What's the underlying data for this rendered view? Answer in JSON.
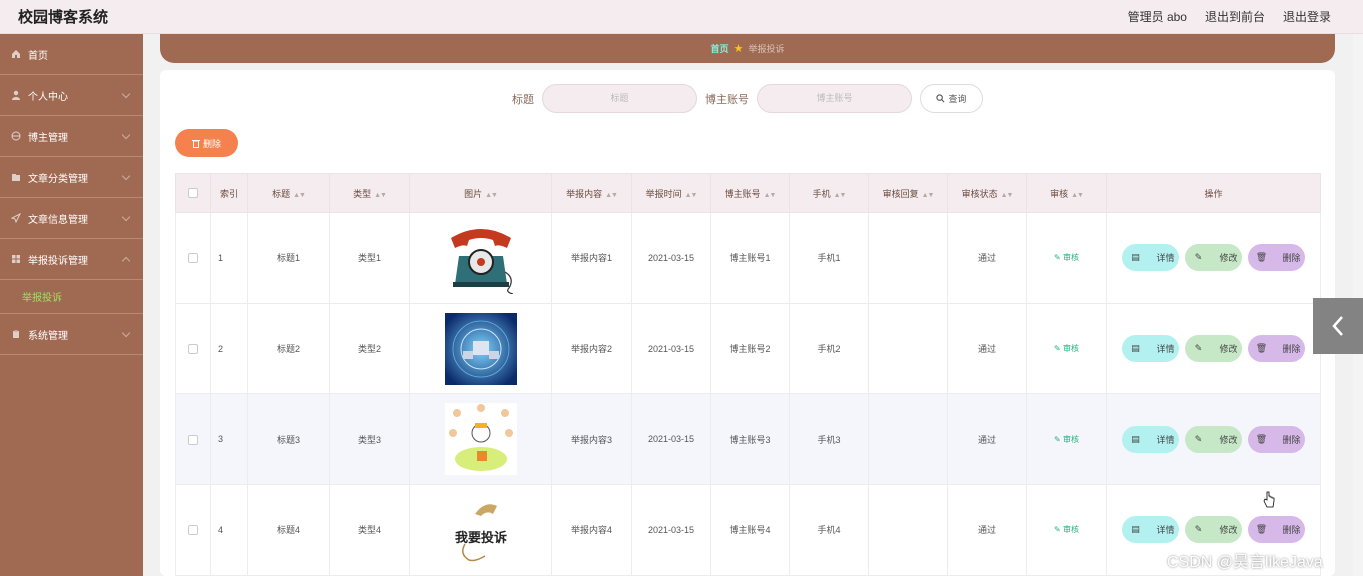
{
  "app_title": "校园博客系统",
  "header": {
    "admin_label": "管理员 abo",
    "to_front_label": "退出到前台",
    "logout_label": "退出登录"
  },
  "sidebar": {
    "items": [
      {
        "label": "首页",
        "icon": "home-icon"
      },
      {
        "label": "个人中心",
        "icon": "user-icon"
      },
      {
        "label": "博主管理",
        "icon": "globe-icon"
      },
      {
        "label": "文章分类管理",
        "icon": "folder-icon"
      },
      {
        "label": "文章信息管理",
        "icon": "send-icon"
      },
      {
        "label": "举报投诉管理",
        "icon": "grid-icon"
      },
      {
        "label": "系统管理",
        "icon": "clipboard-icon"
      }
    ],
    "sub_active": "举报投诉"
  },
  "breadcrumb": {
    "home": "首页",
    "current": "举报投诉"
  },
  "search": {
    "title_label": "标题",
    "title_placeholder": "标题",
    "account_label": "博主账号",
    "account_placeholder": "博主账号",
    "query_label": "查询"
  },
  "toolbar": {
    "delete_label": "删除"
  },
  "table": {
    "headers": [
      "索引",
      "标题",
      "类型",
      "图片",
      "举报内容",
      "举报时间",
      "博主账号",
      "手机",
      "审核回复",
      "审核状态",
      "审核",
      "操作"
    ],
    "rows": [
      {
        "index": "1",
        "title": "标题1",
        "type": "类型1",
        "content": "举报内容1",
        "time": "2021-03-15",
        "account": "博主账号1",
        "phone": "手机1",
        "reply": "",
        "status": "通过",
        "audit": "审核"
      },
      {
        "index": "2",
        "title": "标题2",
        "type": "类型2",
        "content": "举报内容2",
        "time": "2021-03-15",
        "account": "博主账号2",
        "phone": "手机2",
        "reply": "",
        "status": "通过",
        "audit": "审核"
      },
      {
        "index": "3",
        "title": "标题3",
        "type": "类型3",
        "content": "举报内容3",
        "time": "2021-03-15",
        "account": "博主账号3",
        "phone": "手机3",
        "reply": "",
        "status": "通过",
        "audit": "审核"
      },
      {
        "index": "4",
        "title": "标题4",
        "type": "类型4",
        "content": "举报内容4",
        "time": "2021-03-15",
        "account": "博主账号4",
        "phone": "手机4",
        "reply": "",
        "status": "通过",
        "audit": "审核",
        "image_text": "我要投诉"
      }
    ],
    "actions": {
      "detail": "详情",
      "edit": "修改",
      "delete": "删除"
    }
  },
  "watermark": "CSDN @昊言likeJava"
}
